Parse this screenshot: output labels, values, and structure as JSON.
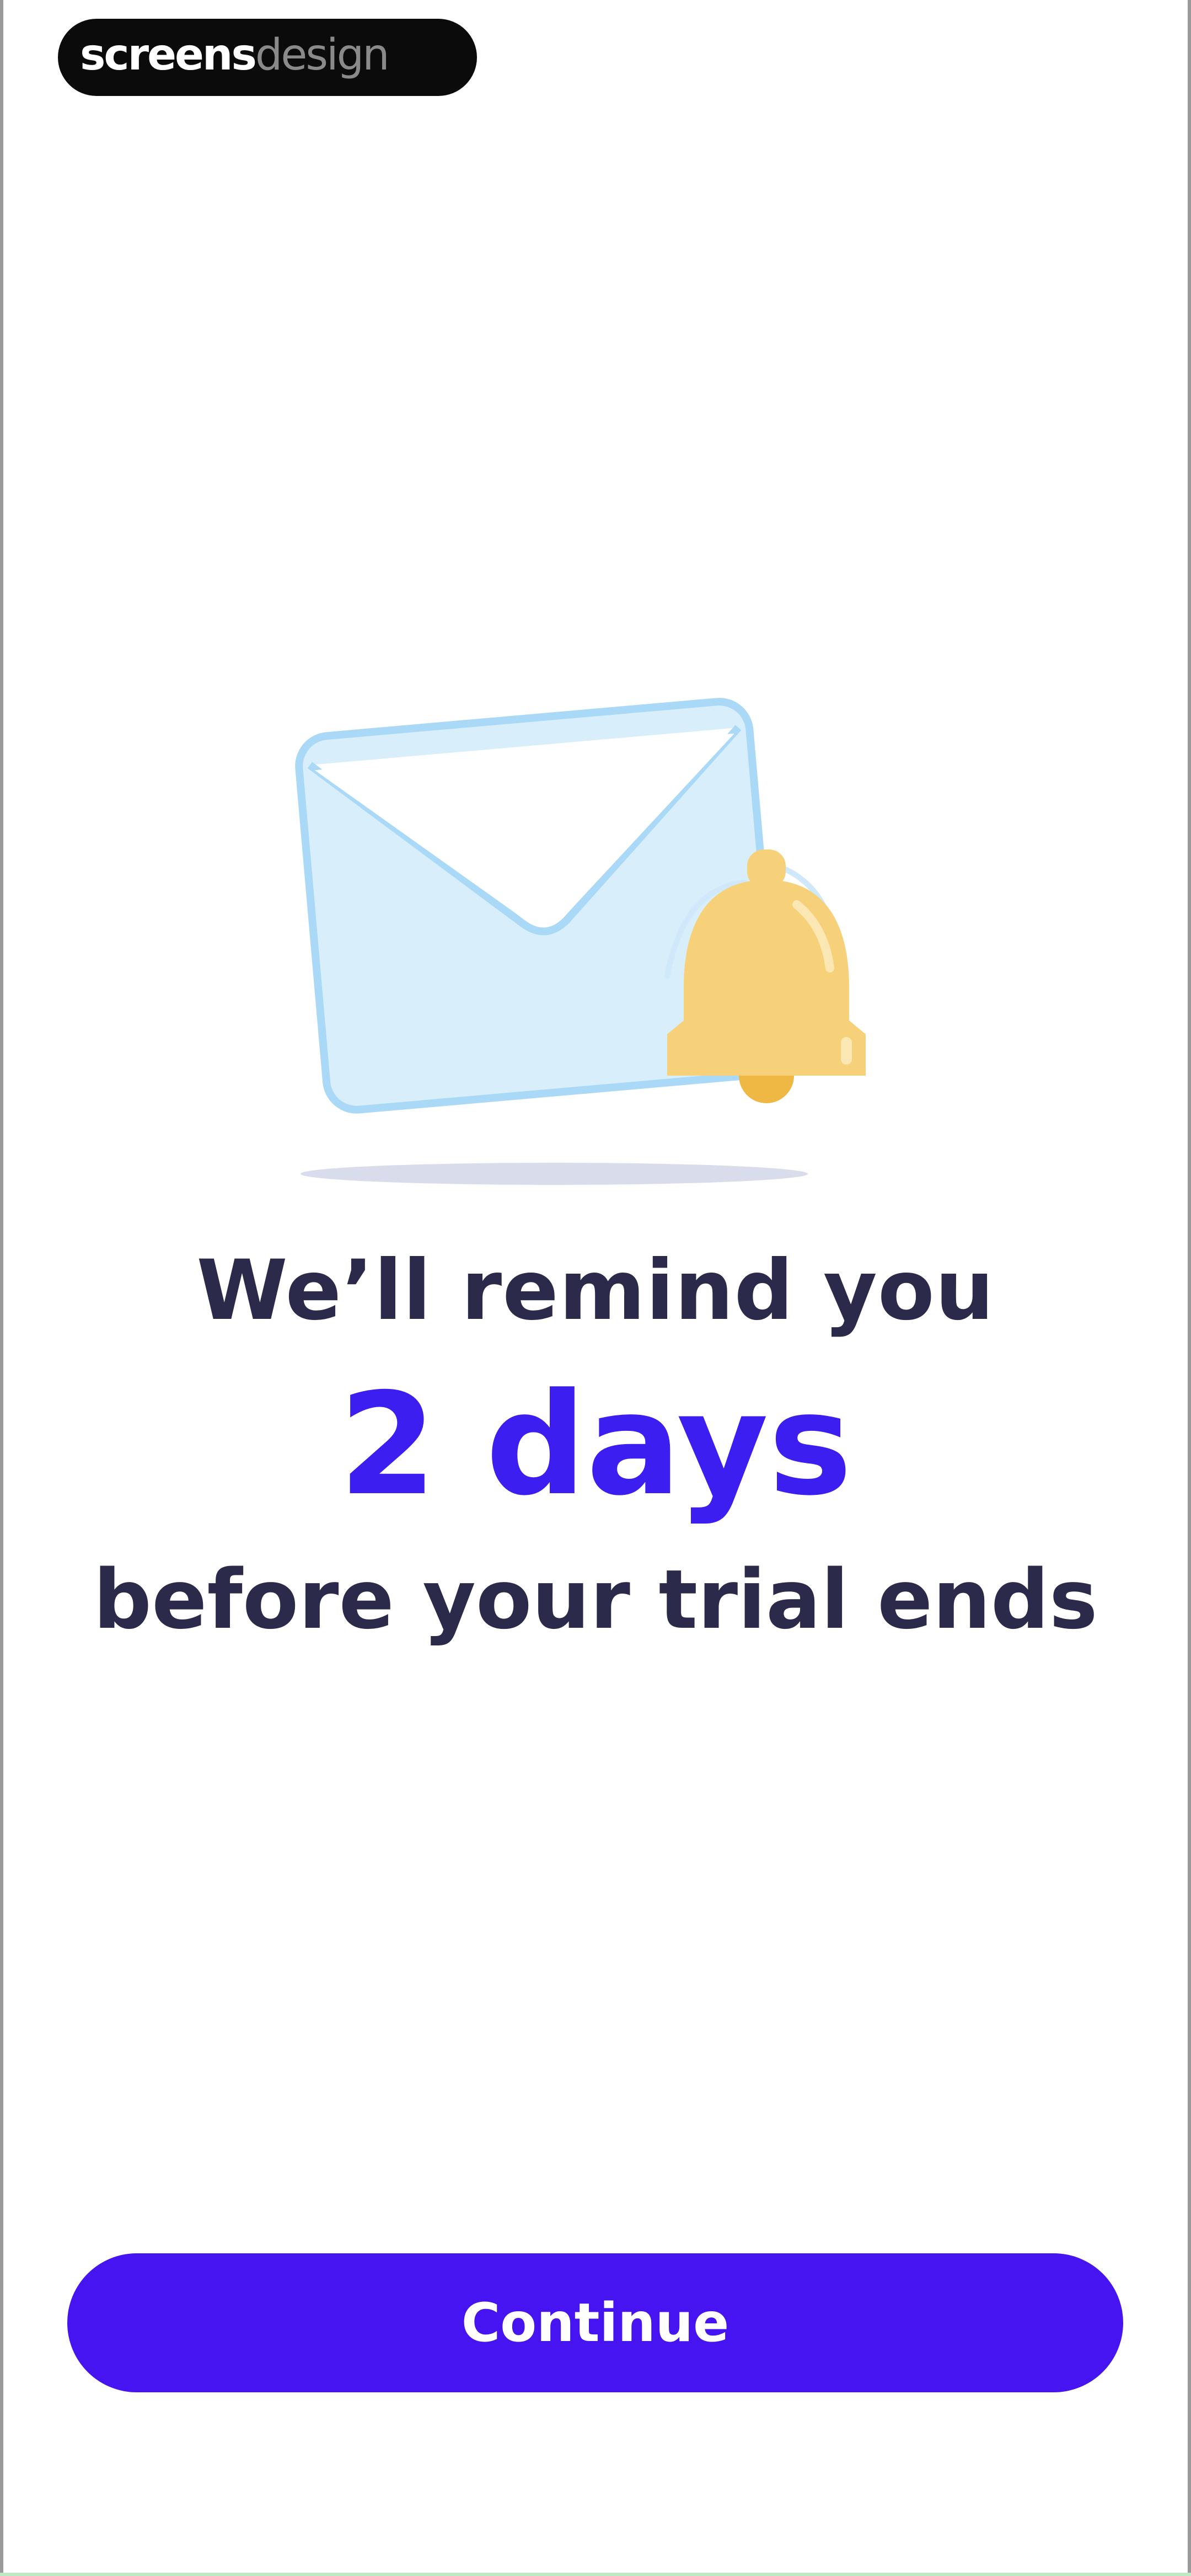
{
  "watermark": {
    "text_bold": "screens",
    "text_light": "design"
  },
  "illustration": {
    "icons": [
      "envelope-icon",
      "bell-icon"
    ],
    "colors": {
      "envelope_fill": "#d8eefb",
      "envelope_stroke": "#a9d9f7",
      "bell_fill": "#f7d07a",
      "bell_clapper": "#efb845",
      "shadow": "#cfd5e6"
    }
  },
  "message": {
    "line1": "We’ll remind you",
    "highlight": "2 days",
    "line3": "before your trial ends"
  },
  "actions": {
    "continue_label": "Continue"
  },
  "colors": {
    "accent": "#4514f0",
    "highlight_text": "#3d1ef0",
    "body_text": "#2c2a4a",
    "background": "#ffffff"
  }
}
